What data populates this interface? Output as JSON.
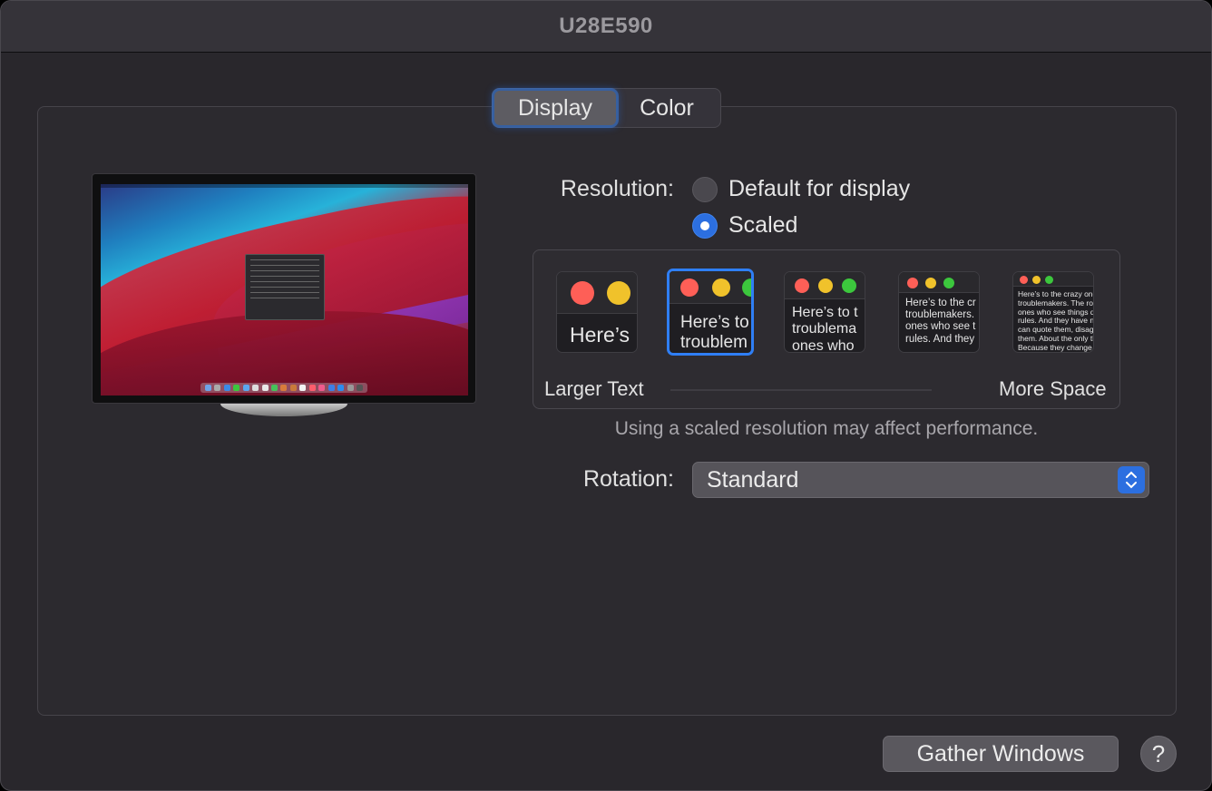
{
  "window": {
    "title": "U28E590"
  },
  "tabs": [
    {
      "label": "Display",
      "selected": true
    },
    {
      "label": "Color",
      "selected": false
    }
  ],
  "resolution": {
    "label": "Resolution:",
    "options": [
      {
        "label": "Default for display",
        "selected": false
      },
      {
        "label": "Scaled",
        "selected": true
      }
    ]
  },
  "scaled": {
    "thumbnails": [
      {
        "text": "Here’s",
        "selected": false
      },
      {
        "text": "Here’s to\ntroublem",
        "selected": true
      },
      {
        "text": "Here’s to t\ntroublema\nones who",
        "selected": false
      },
      {
        "text": "Here’s to the cr\ntroublemakers.\nones who see t\nrules. And they",
        "selected": false
      },
      {
        "text": "Here’s to the crazy ones\ntroublemakers. The rou\nones who see things dif\nrules. And they have no\ncan quote them, disagre\nthem. About the only th\nBecause they change th",
        "selected": false
      }
    ],
    "larger_label": "Larger Text",
    "more_label": "More Space",
    "note": "Using a scaled resolution may affect performance."
  },
  "rotation": {
    "label": "Rotation:",
    "value": "Standard"
  },
  "buttons": {
    "gather": "Gather Windows",
    "help": "?"
  },
  "colors": {
    "accent": "#2c6fe0",
    "traffic_red": "#fe5f57",
    "traffic_yellow": "#f0c22b",
    "traffic_green": "#3cc73d"
  }
}
